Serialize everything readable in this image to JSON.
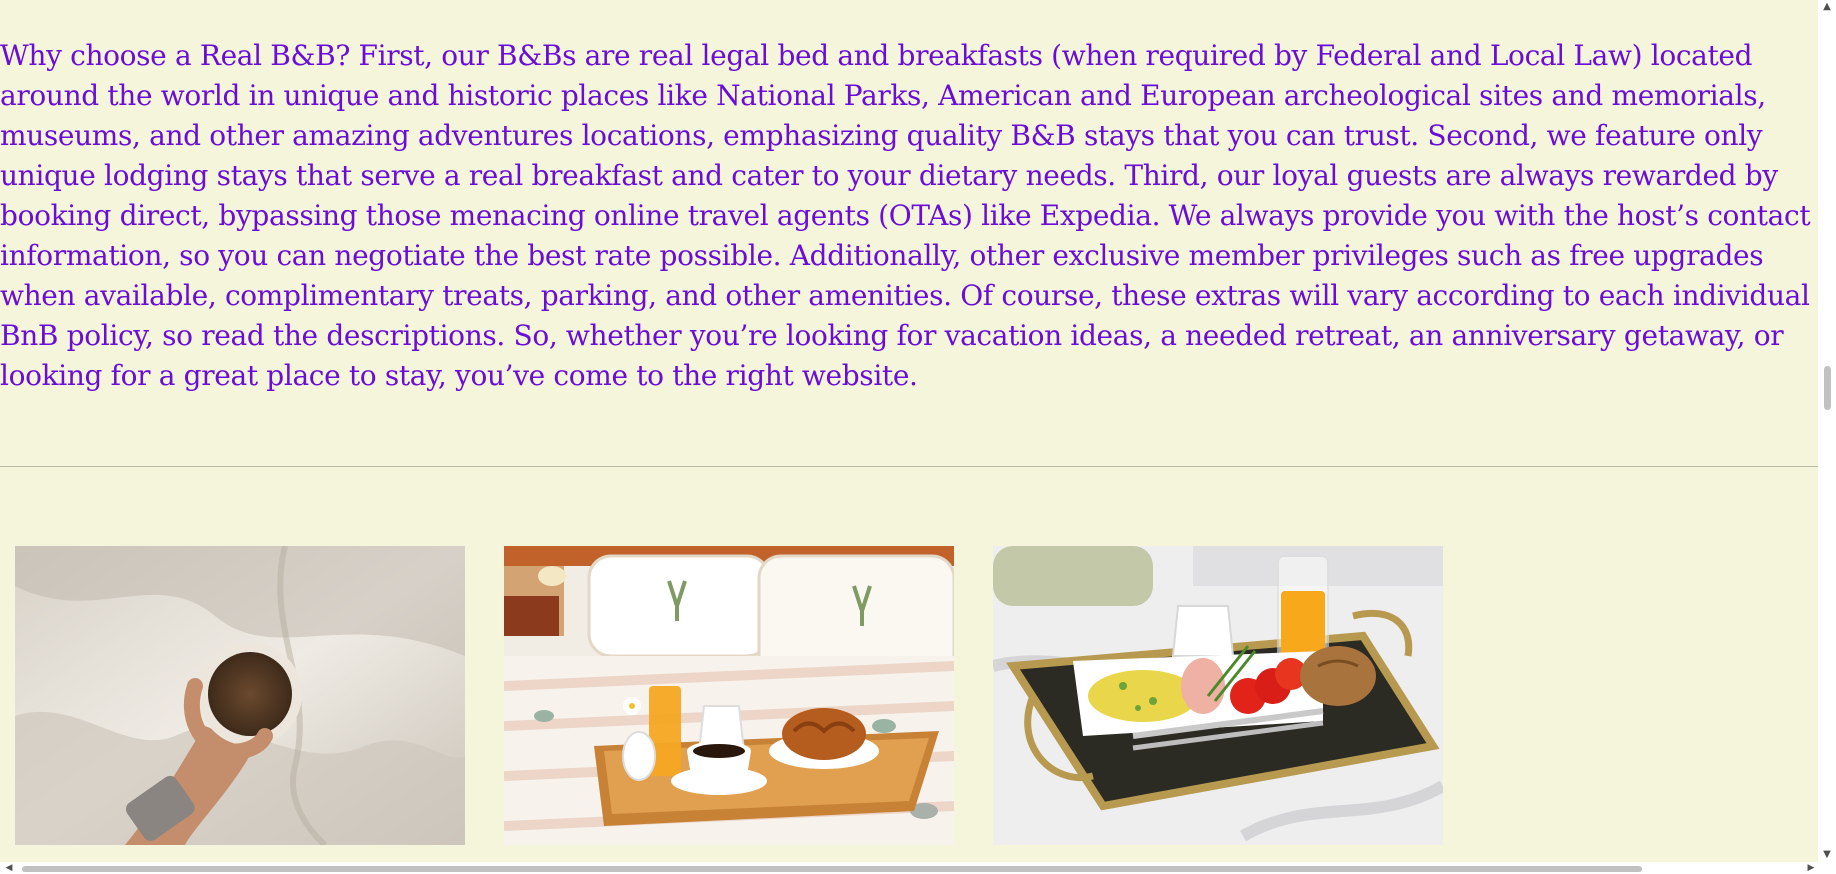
{
  "content": {
    "intro": "Why choose a Real B&B? First, our B&Bs are real legal bed and breakfasts (when required by Federal and Local Law) located around the world in unique and historic places like National Parks, American and European archeological sites and memorials, museums, and other amazing adventures locations, emphasizing quality B&B stays that you can trust. Second, we feature only unique lodging stays that serve a real breakfast and cater to your dietary needs. Third, our loyal guests are always rewarded by booking direct, bypassing those menacing online travel agents (OTAs) like Expedia. We always provide you with the host’s contact information, so you can negotiate the best rate possible. Additionally, other exclusive member privileges such as free upgrades when available, complimentary treats, parking, and other amenities. Of course, these extras will vary according to each individual BnB policy, so read the descriptions. So, whether you’re looking for vacation ideas, a needed retreat, an anniversary getaway, or looking for a great place to stay, you’ve come to the right website."
  },
  "gallery": {
    "photos": [
      {
        "subject": "hand holding a cup of coffee on white bedding"
      },
      {
        "subject": "breakfast tray with coffee, croissant and orange juice on a made bed"
      },
      {
        "subject": "breakfast tray with eggs, ham, tomatoes and orange juice on a bed"
      }
    ]
  },
  "scrollbars": {
    "vertical": {
      "up_icon": "chevron-up-icon",
      "down_icon": "chevron-down-icon",
      "position": 0.44
    },
    "horizontal": {
      "left_icon": "chevron-left-icon",
      "right_icon": "chevron-right-icon",
      "position": 0.0
    }
  },
  "colors": {
    "page_background": "#f5f5dc",
    "text": "#6a0dd8",
    "divider": "#b9b9a8"
  }
}
